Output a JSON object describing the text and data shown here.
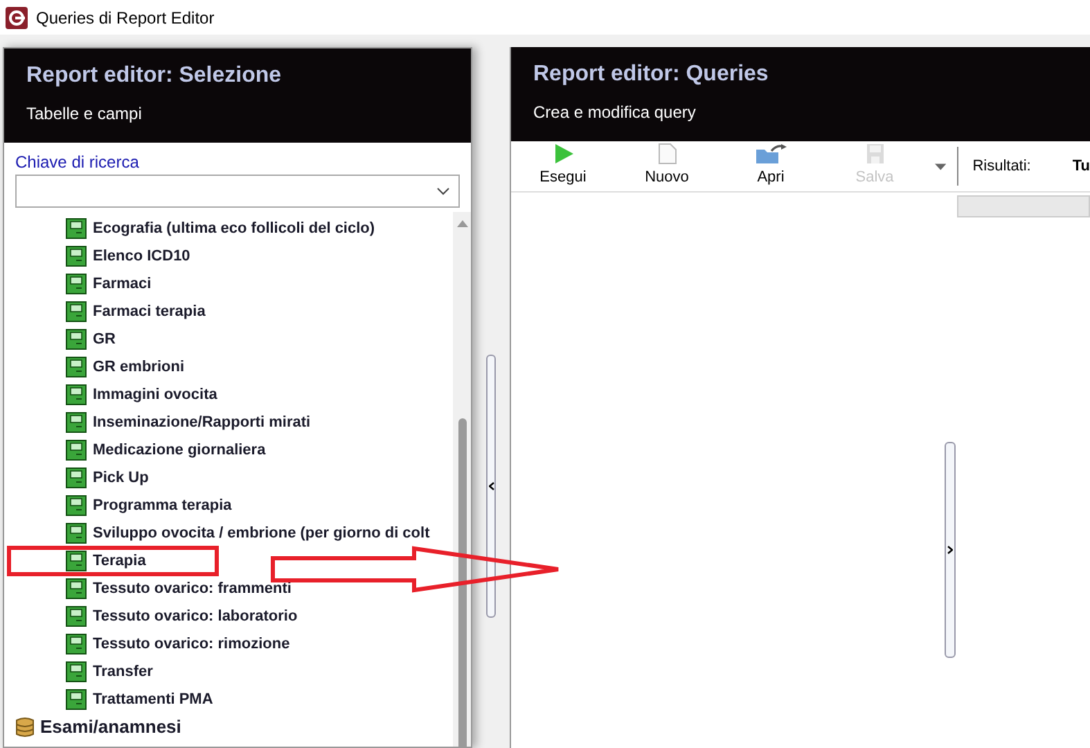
{
  "window": {
    "title": "Queries di Report Editor"
  },
  "left_panel": {
    "title": "Report editor: Selezione",
    "subtitle": "Tabelle e campi",
    "search_label": "Chiave di ricerca",
    "tree": [
      {
        "label": "Ecografia (ultima eco follicoli del ciclo)",
        "kind": "table",
        "highlighted": false
      },
      {
        "label": "Elenco ICD10",
        "kind": "table",
        "highlighted": false
      },
      {
        "label": "Farmaci",
        "kind": "table",
        "highlighted": false
      },
      {
        "label": "Farmaci terapia",
        "kind": "table",
        "highlighted": false
      },
      {
        "label": "GR",
        "kind": "table",
        "highlighted": false
      },
      {
        "label": "GR embrioni",
        "kind": "table",
        "highlighted": false
      },
      {
        "label": "Immagini ovocita",
        "kind": "table",
        "highlighted": false
      },
      {
        "label": "Inseminazione/Rapporti mirati",
        "kind": "table",
        "highlighted": false
      },
      {
        "label": "Medicazione giornaliera",
        "kind": "table",
        "highlighted": false
      },
      {
        "label": "Pick Up",
        "kind": "table",
        "highlighted": false
      },
      {
        "label": "Programma terapia",
        "kind": "table",
        "highlighted": false
      },
      {
        "label": "Sviluppo ovocita / embrione (per giorno di colt",
        "kind": "table",
        "highlighted": false
      },
      {
        "label": "Terapia",
        "kind": "table",
        "highlighted": true
      },
      {
        "label": "Tessuto ovarico: frammenti",
        "kind": "table",
        "highlighted": false
      },
      {
        "label": "Tessuto ovarico: laboratorio",
        "kind": "table",
        "highlighted": false
      },
      {
        "label": "Tessuto ovarico: rimozione",
        "kind": "table",
        "highlighted": false
      },
      {
        "label": "Transfer",
        "kind": "table",
        "highlighted": false
      },
      {
        "label": "Trattamenti PMA",
        "kind": "table",
        "highlighted": false
      },
      {
        "label": "Esami/anamnesi",
        "kind": "group",
        "highlighted": false
      }
    ]
  },
  "right_panel": {
    "title": "Report editor: Queries",
    "subtitle": "Crea e modifica query",
    "toolbar": [
      {
        "label": "Esegui",
        "kind": "run",
        "disabled": false
      },
      {
        "label": "Nuovo",
        "kind": "new",
        "disabled": false
      },
      {
        "label": "Apri",
        "kind": "open",
        "disabled": false
      },
      {
        "label": "Salva",
        "kind": "save",
        "disabled": true
      }
    ],
    "results_label": "Risultati:",
    "results_value": "Tu"
  }
}
